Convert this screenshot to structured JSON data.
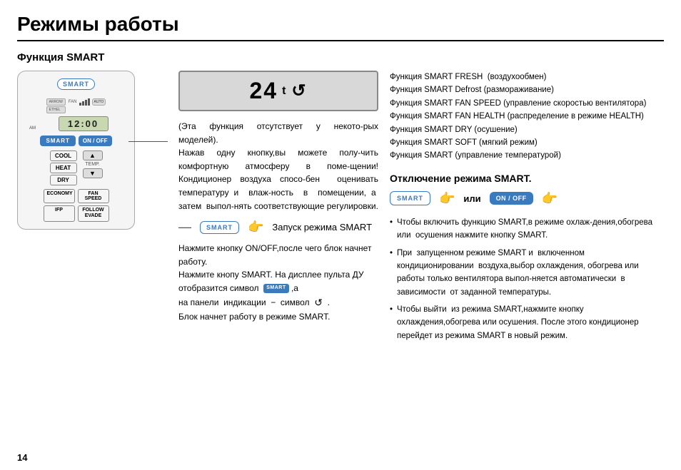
{
  "page": {
    "title": "Режимы работы",
    "page_number": "14"
  },
  "section1": {
    "title": "Функция SMART"
  },
  "remote": {
    "smart_label": "SMART",
    "time": "12:00",
    "am_label": "AM",
    "btn_smart": "SMART",
    "btn_onoff": "ON / OFF",
    "btn_cool": "COOL",
    "btn_heat": "HEAT",
    "btn_dry": "DRY",
    "btn_temp": "TEMP.",
    "btn_economy": "ECONOMY",
    "btn_fan_speed": "FAN SPEED",
    "btn_ifp": "IFP",
    "btn_follow": "FOLLOW\nEVADE",
    "arrow_up": "▲",
    "arrow_down": "▼"
  },
  "display": {
    "temp": "24",
    "degree": "t",
    "symbol": "↺"
  },
  "mid_text1": "(Эта  функция  отсутствует  у  некото-рых моделей).\nНажав одну кнопку,вы можете полу-чить комфортную атмосферу в поме-щении! Кондиционер воздуха спосо-бен  оценивать температуру и  влаж-ность  в  помещении, а  затем  выпол-нять соответствующие регулировки.",
  "smart_launch_label": "SMART",
  "smart_launch_text": "Запуск режима SMART",
  "mid_text2": "Нажмите кнопку ON/OFF,после чего блок начнет работу.\nНажмите кнопу SMART. На дисплее пульта ДУ отобразится символ",
  "mid_text3": ",а на панели  индикации  −  символ",
  "mid_text4": ".\nБлок начнет работу в режиме SMART.",
  "features": [
    "Функция SMART FRESH  (воздухообмен)",
    "Функция SMART Defrost (размораживание)",
    "Функция SMART FAN SPEED (управление скоростью вентилятора)",
    "Функция SMART FAN HEALTH (распределение в режиме HEALTH)",
    "Функция SMART DRY (осушение)",
    "Функция SMART SOFT (мягкий режим)",
    "Функция SMART (управление температурой)"
  ],
  "section2": {
    "title": "Отключение режима SMART."
  },
  "or_text": "или",
  "bullets": [
    "Чтобы включить функцию SMART,в режиме охлаж-дения,обогрева или  осушения нажмите кнопку SMART.",
    "При  запущенном режиме SMART и  включенном кондиционировании  воздуха,выбор охлаждения, обогрева или  работы только вентилятора выпол-няется автоматически  в зависимости  от заданной температуры.",
    "Чтобы выйти  из режима SMART,нажмите кнопку охлаждения,обогрева или осушения. После этого кондиционер перейдет из режима SMART в новый режим."
  ]
}
